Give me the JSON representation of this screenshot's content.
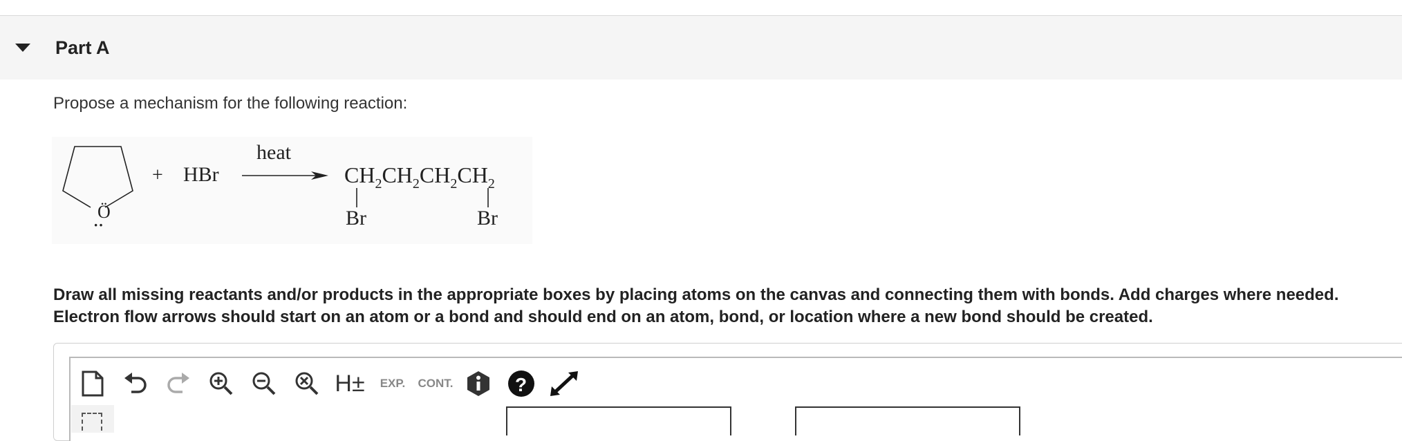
{
  "part": {
    "title": "Part A"
  },
  "prompt": "Propose a mechanism for the following reaction:",
  "reaction": {
    "plus": "+",
    "reagent": "HBr",
    "condition": "heat",
    "oxygen": "Ö",
    "oxygen_lone_pair": "··",
    "product_chain": "CH2CH2CH2CH2",
    "product_br_left": "Br",
    "product_br_right": "Br"
  },
  "instructions": "Draw all missing reactants and/or products in the appropriate boxes by placing atoms on the canvas and connecting them with bonds. Add charges where needed. Electron flow arrows should start on an atom or a bond and should end on an atom, bond, or location where a new bond should be created.",
  "toolbar": {
    "exp_label": "EXP.",
    "cont_label": "CONT.",
    "h_label": "H±",
    "buttons": [
      "new-document-icon",
      "undo-icon",
      "redo-icon",
      "zoom-in-icon",
      "zoom-out-icon",
      "reset-zoom-icon",
      "explicit-hydrogens",
      "expand-label",
      "contract-label",
      "info-icon",
      "help-icon",
      "fullscreen-icon"
    ]
  },
  "colors": {
    "header_bg": "#f5f5f5",
    "border": "#d9d9d9",
    "text": "#222222"
  }
}
